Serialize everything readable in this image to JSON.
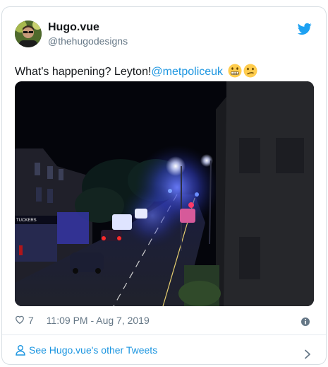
{
  "tweet": {
    "author": {
      "name": "Hugo.vue",
      "handle": "@thehugodesigns"
    },
    "text_prefix": "What's happening? Leyton!",
    "mention": "@metpoliceuk",
    "emojis": [
      "grimacing-face",
      "confused-face"
    ],
    "media": {
      "description_icon": "night-street-photo",
      "shop_sign": "TUCKERS"
    },
    "likes": "7",
    "timestamp": "11:09 PM - Aug 7, 2019",
    "footer_link": "See Hugo.vue's other Tweets"
  },
  "colors": {
    "link": "#1b95e0",
    "secondary_text": "#657786",
    "border": "#d7dee3",
    "twitter_blue": "#1da1f2"
  }
}
